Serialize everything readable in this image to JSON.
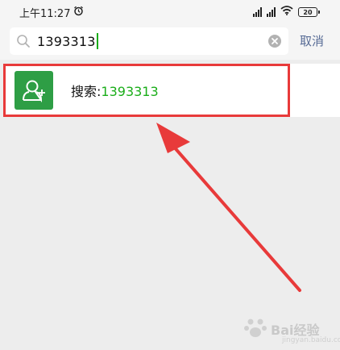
{
  "status": {
    "time": "上午11:27",
    "battery": "20"
  },
  "search": {
    "query": "1393313",
    "cancel_label": "取消"
  },
  "result": {
    "label": "搜索:",
    "query": "1393313"
  },
  "watermark": {
    "text": "Bai经验",
    "subtext": "jingyan.baidu.com"
  },
  "colors": {
    "accent_green": "#1aad19",
    "avatar_green": "#2e9e45",
    "link_blue": "#576b95",
    "highlight_red": "#e83a3a"
  },
  "icons": [
    "alarm-icon",
    "signal-icon",
    "wifi-icon",
    "battery-icon",
    "search-icon",
    "clear-icon",
    "add-friend-icon",
    "arrow-annotation"
  ]
}
